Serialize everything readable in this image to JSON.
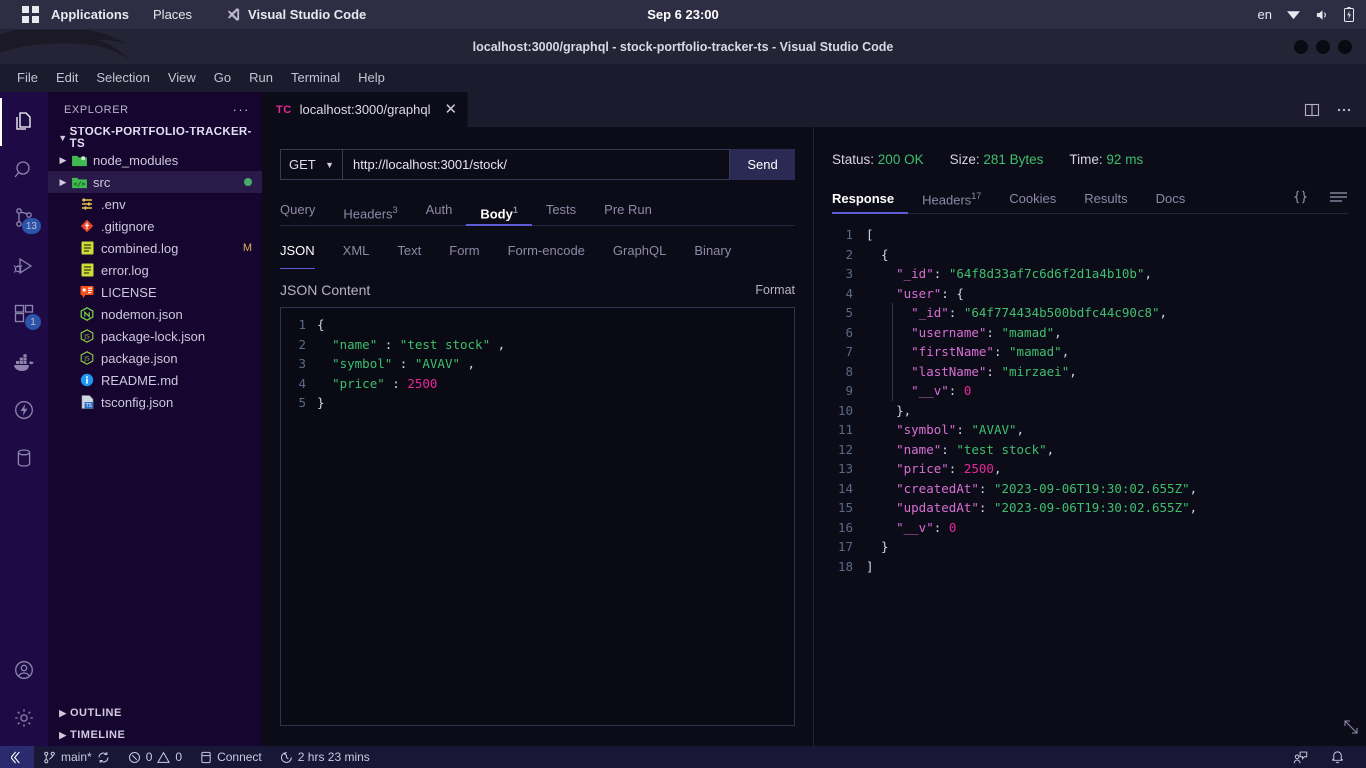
{
  "os_panel": {
    "apps_label": "Applications",
    "places_label": "Places",
    "active_app": "Visual Studio Code",
    "clock": "Sep 6  23:00",
    "language": "en",
    "icons": [
      "wifi-icon",
      "volume-icon",
      "battery-icon"
    ]
  },
  "window": {
    "title": "localhost:3000/graphql - stock-portfolio-tracker-ts - Visual Studio Code",
    "menu": [
      "File",
      "Edit",
      "Selection",
      "View",
      "Go",
      "Run",
      "Terminal",
      "Help"
    ]
  },
  "activity_bar": {
    "items": [
      {
        "name": "explorer",
        "icon": "files-icon",
        "active": true,
        "badge": ""
      },
      {
        "name": "search",
        "icon": "search-icon",
        "active": false,
        "badge": ""
      },
      {
        "name": "source-control",
        "icon": "source-control-icon",
        "active": false,
        "badge": "13"
      },
      {
        "name": "run-and-debug",
        "icon": "debug-icon",
        "active": false,
        "badge": ""
      },
      {
        "name": "extensions",
        "icon": "extensions-icon",
        "active": false,
        "badge": "1"
      },
      {
        "name": "docker",
        "icon": "docker-icon",
        "active": false,
        "badge": ""
      },
      {
        "name": "thunder-client",
        "icon": "lightning-icon",
        "active": false,
        "badge": ""
      },
      {
        "name": "database",
        "icon": "database-icon",
        "active": false,
        "badge": ""
      }
    ],
    "bottom": [
      {
        "name": "accounts",
        "icon": "account-icon"
      },
      {
        "name": "settings",
        "icon": "gear-icon"
      }
    ]
  },
  "sidebar": {
    "title": "EXPLORER",
    "more_actions": "···",
    "root_folder": "STOCK-PORTFOLIO-TRACKER-TS",
    "items": [
      {
        "label": "node_modules",
        "type": "folder",
        "icon": "folder-node-icon",
        "indent": 1,
        "expandable": true,
        "selected": false,
        "badge": ""
      },
      {
        "label": "src",
        "type": "folder",
        "icon": "folder-src-icon",
        "indent": 1,
        "expandable": true,
        "selected": true,
        "badge": "dot-green"
      },
      {
        "label": ".env",
        "type": "file",
        "icon": "env-icon",
        "indent": 2,
        "expandable": false,
        "selected": false,
        "badge": ""
      },
      {
        "label": ".gitignore",
        "type": "file",
        "icon": "git-icon",
        "indent": 2,
        "expandable": false,
        "selected": false,
        "badge": ""
      },
      {
        "label": "combined.log",
        "type": "file",
        "icon": "log-icon",
        "indent": 2,
        "expandable": false,
        "selected": false,
        "badge": "M"
      },
      {
        "label": "error.log",
        "type": "file",
        "icon": "log-icon",
        "indent": 2,
        "expandable": false,
        "selected": false,
        "badge": ""
      },
      {
        "label": "LICENSE",
        "type": "file",
        "icon": "license-icon",
        "indent": 2,
        "expandable": false,
        "selected": false,
        "badge": ""
      },
      {
        "label": "nodemon.json",
        "type": "file",
        "icon": "nodemon-icon",
        "indent": 2,
        "expandable": false,
        "selected": false,
        "badge": ""
      },
      {
        "label": "package-lock.json",
        "type": "file",
        "icon": "npm-icon",
        "indent": 2,
        "expandable": false,
        "selected": false,
        "badge": ""
      },
      {
        "label": "package.json",
        "type": "file",
        "icon": "npm-icon",
        "indent": 2,
        "expandable": false,
        "selected": false,
        "badge": ""
      },
      {
        "label": "README.md",
        "type": "file",
        "icon": "readme-icon",
        "indent": 2,
        "expandable": false,
        "selected": false,
        "badge": ""
      },
      {
        "label": "tsconfig.json",
        "type": "file",
        "icon": "tsconfig-icon",
        "indent": 2,
        "expandable": false,
        "selected": false,
        "badge": ""
      }
    ],
    "sections": [
      "OUTLINE",
      "TIMELINE"
    ]
  },
  "editor": {
    "tab": {
      "icon_label": "TC",
      "title": "localhost:3000/graphql",
      "close": "✕"
    },
    "actions": [
      "split-editor-icon",
      "more-actions-icon"
    ]
  },
  "request": {
    "method": "GET",
    "url": "http://localhost:3001/stock/",
    "send_label": "Send",
    "tabs": [
      {
        "label": "Query",
        "count": "",
        "active": false
      },
      {
        "label": "Headers",
        "count": "3",
        "active": false
      },
      {
        "label": "Auth",
        "count": "",
        "active": false
      },
      {
        "label": "Body",
        "count": "1",
        "active": true
      },
      {
        "label": "Tests",
        "count": "",
        "active": false
      },
      {
        "label": "Pre Run",
        "count": "",
        "active": false
      }
    ],
    "body_formats": [
      {
        "label": "JSON",
        "active": true
      },
      {
        "label": "XML",
        "active": false
      },
      {
        "label": "Text",
        "active": false
      },
      {
        "label": "Form",
        "active": false
      },
      {
        "label": "Form-encode",
        "active": false
      },
      {
        "label": "GraphQL",
        "active": false
      },
      {
        "label": "Binary",
        "active": false
      }
    ],
    "json_content_label": "JSON Content",
    "format_label": "Format",
    "json_body_lines": [
      {
        "n": "1",
        "tokens": [
          {
            "t": "{",
            "c": "p"
          }
        ]
      },
      {
        "n": "2",
        "tokens": [
          {
            "t": "  ",
            "c": "p"
          },
          {
            "t": "\"name\"",
            "c": "s"
          },
          {
            "t": " : ",
            "c": "p"
          },
          {
            "t": "\"test stock\"",
            "c": "s"
          },
          {
            "t": " ,",
            "c": "p"
          }
        ]
      },
      {
        "n": "3",
        "tokens": [
          {
            "t": "  ",
            "c": "p"
          },
          {
            "t": "\"symbol\"",
            "c": "s"
          },
          {
            "t": " : ",
            "c": "p"
          },
          {
            "t": "\"AVAV\"",
            "c": "s"
          },
          {
            "t": " ,",
            "c": "p"
          }
        ]
      },
      {
        "n": "4",
        "tokens": [
          {
            "t": "  ",
            "c": "p"
          },
          {
            "t": "\"price\"",
            "c": "s"
          },
          {
            "t": " : ",
            "c": "p"
          },
          {
            "t": "2500",
            "c": "n"
          }
        ]
      },
      {
        "n": "5",
        "tokens": [
          {
            "t": "}",
            "c": "p"
          }
        ]
      }
    ]
  },
  "response": {
    "status_label": "Status:",
    "status_value": "200 OK",
    "size_label": "Size:",
    "size_value": "281 Bytes",
    "time_label": "Time:",
    "time_value": "92 ms",
    "tabs": [
      {
        "label": "Response",
        "count": "",
        "active": true
      },
      {
        "label": "Headers",
        "count": "17",
        "active": false
      },
      {
        "label": "Cookies",
        "count": "",
        "active": false
      },
      {
        "label": "Results",
        "count": "",
        "active": false
      },
      {
        "label": "Docs",
        "count": "",
        "active": false
      }
    ],
    "actions": [
      "braces-icon",
      "menu-icon"
    ],
    "body_lines": [
      {
        "n": "1",
        "tokens": [
          {
            "t": "[",
            "c": "p"
          }
        ]
      },
      {
        "n": "2",
        "tokens": [
          {
            "t": "  {",
            "c": "p"
          }
        ]
      },
      {
        "n": "3",
        "tokens": [
          {
            "t": "    ",
            "c": "p"
          },
          {
            "t": "\"_id\"",
            "c": "k"
          },
          {
            "t": ": ",
            "c": "p"
          },
          {
            "t": "\"64f8d33af7c6d6f2d1a4b10b\"",
            "c": "s"
          },
          {
            "t": ",",
            "c": "p"
          }
        ]
      },
      {
        "n": "4",
        "tokens": [
          {
            "t": "    ",
            "c": "p"
          },
          {
            "t": "\"user\"",
            "c": "k"
          },
          {
            "t": ": {",
            "c": "p"
          }
        ]
      },
      {
        "n": "5",
        "tokens": [
          {
            "t": "      ",
            "c": "p"
          },
          {
            "t": "\"_id\"",
            "c": "k"
          },
          {
            "t": ": ",
            "c": "p"
          },
          {
            "t": "\"64f774434b500bdfc44c90c8\"",
            "c": "s"
          },
          {
            "t": ",",
            "c": "p"
          }
        ]
      },
      {
        "n": "6",
        "tokens": [
          {
            "t": "      ",
            "c": "p"
          },
          {
            "t": "\"username\"",
            "c": "k"
          },
          {
            "t": ": ",
            "c": "p"
          },
          {
            "t": "\"mamad\"",
            "c": "s"
          },
          {
            "t": ",",
            "c": "p"
          }
        ]
      },
      {
        "n": "7",
        "tokens": [
          {
            "t": "      ",
            "c": "p"
          },
          {
            "t": "\"firstName\"",
            "c": "k"
          },
          {
            "t": ": ",
            "c": "p"
          },
          {
            "t": "\"mamad\"",
            "c": "s"
          },
          {
            "t": ",",
            "c": "p"
          }
        ]
      },
      {
        "n": "8",
        "tokens": [
          {
            "t": "      ",
            "c": "p"
          },
          {
            "t": "\"lastName\"",
            "c": "k"
          },
          {
            "t": ": ",
            "c": "p"
          },
          {
            "t": "\"mirzaei\"",
            "c": "s"
          },
          {
            "t": ",",
            "c": "p"
          }
        ]
      },
      {
        "n": "9",
        "tokens": [
          {
            "t": "      ",
            "c": "p"
          },
          {
            "t": "\"__v\"",
            "c": "k"
          },
          {
            "t": ": ",
            "c": "p"
          },
          {
            "t": "0",
            "c": "n"
          }
        ]
      },
      {
        "n": "10",
        "tokens": [
          {
            "t": "    },",
            "c": "p"
          }
        ]
      },
      {
        "n": "11",
        "tokens": [
          {
            "t": "    ",
            "c": "p"
          },
          {
            "t": "\"symbol\"",
            "c": "k"
          },
          {
            "t": ": ",
            "c": "p"
          },
          {
            "t": "\"AVAV\"",
            "c": "s"
          },
          {
            "t": ",",
            "c": "p"
          }
        ]
      },
      {
        "n": "12",
        "tokens": [
          {
            "t": "    ",
            "c": "p"
          },
          {
            "t": "\"name\"",
            "c": "k"
          },
          {
            "t": ": ",
            "c": "p"
          },
          {
            "t": "\"test stock\"",
            "c": "s"
          },
          {
            "t": ",",
            "c": "p"
          }
        ]
      },
      {
        "n": "13",
        "tokens": [
          {
            "t": "    ",
            "c": "p"
          },
          {
            "t": "\"price\"",
            "c": "k"
          },
          {
            "t": ": ",
            "c": "p"
          },
          {
            "t": "2500",
            "c": "n"
          },
          {
            "t": ",",
            "c": "p"
          }
        ]
      },
      {
        "n": "14",
        "tokens": [
          {
            "t": "    ",
            "c": "p"
          },
          {
            "t": "\"createdAt\"",
            "c": "k"
          },
          {
            "t": ": ",
            "c": "p"
          },
          {
            "t": "\"2023-09-06T19:30:02.655Z\"",
            "c": "s"
          },
          {
            "t": ",",
            "c": "p"
          }
        ]
      },
      {
        "n": "15",
        "tokens": [
          {
            "t": "    ",
            "c": "p"
          },
          {
            "t": "\"updatedAt\"",
            "c": "k"
          },
          {
            "t": ": ",
            "c": "p"
          },
          {
            "t": "\"2023-09-06T19:30:02.655Z\"",
            "c": "s"
          },
          {
            "t": ",",
            "c": "p"
          }
        ]
      },
      {
        "n": "16",
        "tokens": [
          {
            "t": "    ",
            "c": "p"
          },
          {
            "t": "\"__v\"",
            "c": "k"
          },
          {
            "t": ": ",
            "c": "p"
          },
          {
            "t": "0",
            "c": "n"
          }
        ]
      },
      {
        "n": "17",
        "tokens": [
          {
            "t": "  }",
            "c": "p"
          }
        ]
      },
      {
        "n": "18",
        "tokens": [
          {
            "t": "]",
            "c": "p"
          }
        ]
      }
    ]
  },
  "status_bar": {
    "branch": "main*",
    "errors": "0",
    "warnings": "0",
    "connect": "Connect",
    "timer": "2 hrs 23 mins",
    "right_icons": [
      "feedback-icon",
      "bell-icon"
    ]
  },
  "colors": {
    "accent": "#5e5bd6",
    "success": "#3fbf6e",
    "badge": "#2f6fd0",
    "tab_icon": "#e5279a"
  }
}
